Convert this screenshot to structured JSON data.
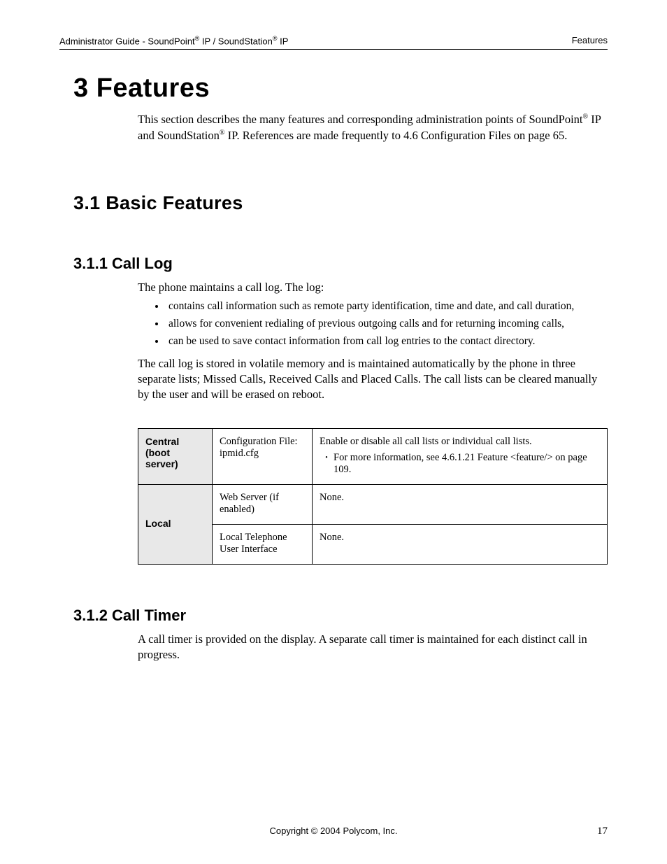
{
  "header": {
    "left_prefix": "Administrator Guide - SoundPoint",
    "left_mid": " IP / SoundStation",
    "left_suffix": " IP",
    "right": "Features"
  },
  "h1": "3  Features",
  "intro": {
    "p1a": "This section describes the many features and corresponding administration points of SoundPoint",
    "p1b": " IP and SoundStation",
    "p1c": " IP.  References are made frequently to 4.6 Configuration Files on page 65."
  },
  "h2": "3.1  Basic Features",
  "s311": {
    "title": "3.1.1  Call Log",
    "lead": "The phone maintains a call log.  The log:",
    "bullets": [
      "contains call information such as remote party identification, time and date, and call duration,",
      "allows for convenient redialing of previous outgoing calls and for returning incoming calls,",
      "can be used to save contact information from call log entries to the contact directory."
    ],
    "after": "The call log is stored in volatile memory and is maintained automatically by the phone in three separate lists; Missed Calls, Received Calls and Placed Calls.  The call lists can be cleared manually by the user and will be erased on reboot."
  },
  "table": {
    "r1_label": "Central (boot server)",
    "r1_mid": "Configuration File: ipmid.cfg",
    "r1_desc_main": "Enable or disable all call lists or individual call lists.",
    "r1_desc_sub": "For more information, see 4.6.1.21 Feature <feature/> on page 109.",
    "r23_label": "Local",
    "r2_mid": "Web Server (if enabled)",
    "r2_desc": "None.",
    "r3_mid": "Local Telephone User Interface",
    "r3_desc": "None."
  },
  "s312": {
    "title": "3.1.2  Call Timer",
    "body": "A call timer is provided on the display.  A separate call timer is maintained for each distinct call in progress."
  },
  "footer": {
    "copyright": "Copyright © 2004 Polycom, Inc.",
    "page": "17"
  }
}
